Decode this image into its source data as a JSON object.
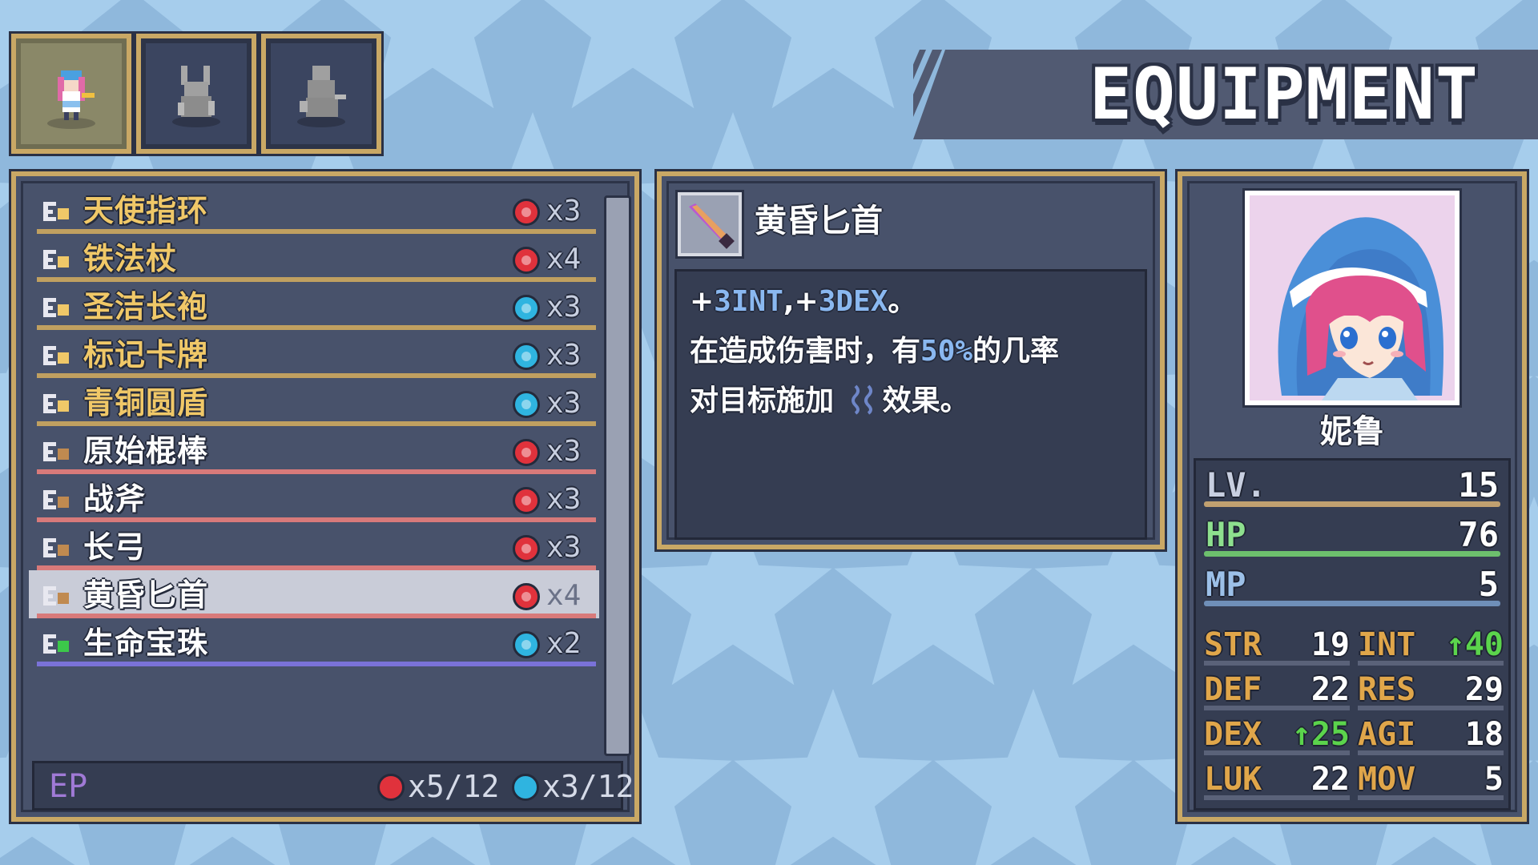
{
  "screen_title": "EQUIPMENT",
  "character_tabs": [
    {
      "name": "tab-character-1",
      "active": true
    },
    {
      "name": "tab-character-2",
      "active": false
    },
    {
      "name": "tab-character-3",
      "active": false
    }
  ],
  "equipment_list": [
    {
      "type_icon": "accessory-icon",
      "name": "天使指环",
      "name_color": "#f0c868",
      "orb": "red",
      "cost": "x3",
      "line_color": "#c0a060",
      "selected": false
    },
    {
      "type_icon": "staff-icon",
      "name": "铁法杖",
      "name_color": "#f0c868",
      "orb": "red",
      "cost": "x4",
      "line_color": "#c0a060",
      "selected": false
    },
    {
      "type_icon": "armor-icon",
      "name": "圣洁长袍",
      "name_color": "#f0c868",
      "orb": "blue",
      "cost": "x3",
      "line_color": "#c0a060",
      "selected": false
    },
    {
      "type_icon": "card-icon",
      "name": "标记卡牌",
      "name_color": "#f0c868",
      "orb": "blue",
      "cost": "x3",
      "line_color": "#c0a060",
      "selected": false
    },
    {
      "type_icon": "shield-icon",
      "name": "青铜圆盾",
      "name_color": "#f0c868",
      "orb": "blue",
      "cost": "x3",
      "line_color": "#c0a060",
      "selected": false
    },
    {
      "type_icon": "club-icon",
      "name": "原始棍棒",
      "name_color": "#ffffff",
      "orb": "red",
      "cost": "x3",
      "line_color": "#d87a7a",
      "selected": false
    },
    {
      "type_icon": "axe-icon",
      "name": "战斧",
      "name_color": "#ffffff",
      "orb": "red",
      "cost": "x3",
      "line_color": "#d87a7a",
      "selected": false
    },
    {
      "type_icon": "bow-icon",
      "name": "长弓",
      "name_color": "#ffffff",
      "orb": "red",
      "cost": "x3",
      "line_color": "#d87a7a",
      "selected": false
    },
    {
      "type_icon": "dagger-icon",
      "name": "黄昏匕首",
      "name_color": "#ffffff",
      "orb": "red",
      "cost": "x4",
      "line_color": "#d87a7a",
      "selected": true
    },
    {
      "type_icon": "orb-icon",
      "name": "生命宝珠",
      "name_color": "#ffffff",
      "orb": "blue",
      "cost": "x2",
      "line_color": "#7a72d8",
      "selected": false
    }
  ],
  "ep": {
    "label": "EP",
    "red": "x5/12",
    "blue": "x3/12"
  },
  "detail": {
    "icon": "dagger-icon",
    "name": "黄昏匕首",
    "line1": {
      "p1": "+",
      "v1": "3INT",
      "p2": ",+",
      "v2": "3DEX",
      "p3": "。"
    },
    "line2": {
      "pre": "在造成伤害时，有",
      "pct": "50%",
      "post": "的几率"
    },
    "line3": {
      "pre": "对目标施加",
      "post": "效果。"
    },
    "status_icon": "wave-status-icon"
  },
  "character": {
    "name": "妮鲁",
    "level_label": "LV.",
    "level": "15",
    "hp_label": "HP",
    "hp": "76",
    "mp_label": "MP",
    "mp": "5",
    "stats": [
      {
        "label": "STR",
        "value": "19",
        "up": false
      },
      {
        "label": "INT",
        "value": "↑40",
        "up": true
      },
      {
        "label": "DEF",
        "value": "22",
        "up": false
      },
      {
        "label": "RES",
        "value": "29",
        "up": false
      },
      {
        "label": "DEX",
        "value": "↑25",
        "up": true
      },
      {
        "label": "AGI",
        "value": "18",
        "up": false
      },
      {
        "label": "LUK",
        "value": "22",
        "up": false
      },
      {
        "label": "MOV",
        "value": "5",
        "up": false
      }
    ]
  },
  "colors": {
    "orb_red": "#e0323c",
    "orb_blue": "#2fb4e0",
    "hp_bar": "#6dc06d",
    "mp_bar": "#6f8fb8",
    "lv_bar": "#c0a070",
    "stat_label": "#e0a64a",
    "stat_up": "#5bd44c"
  }
}
